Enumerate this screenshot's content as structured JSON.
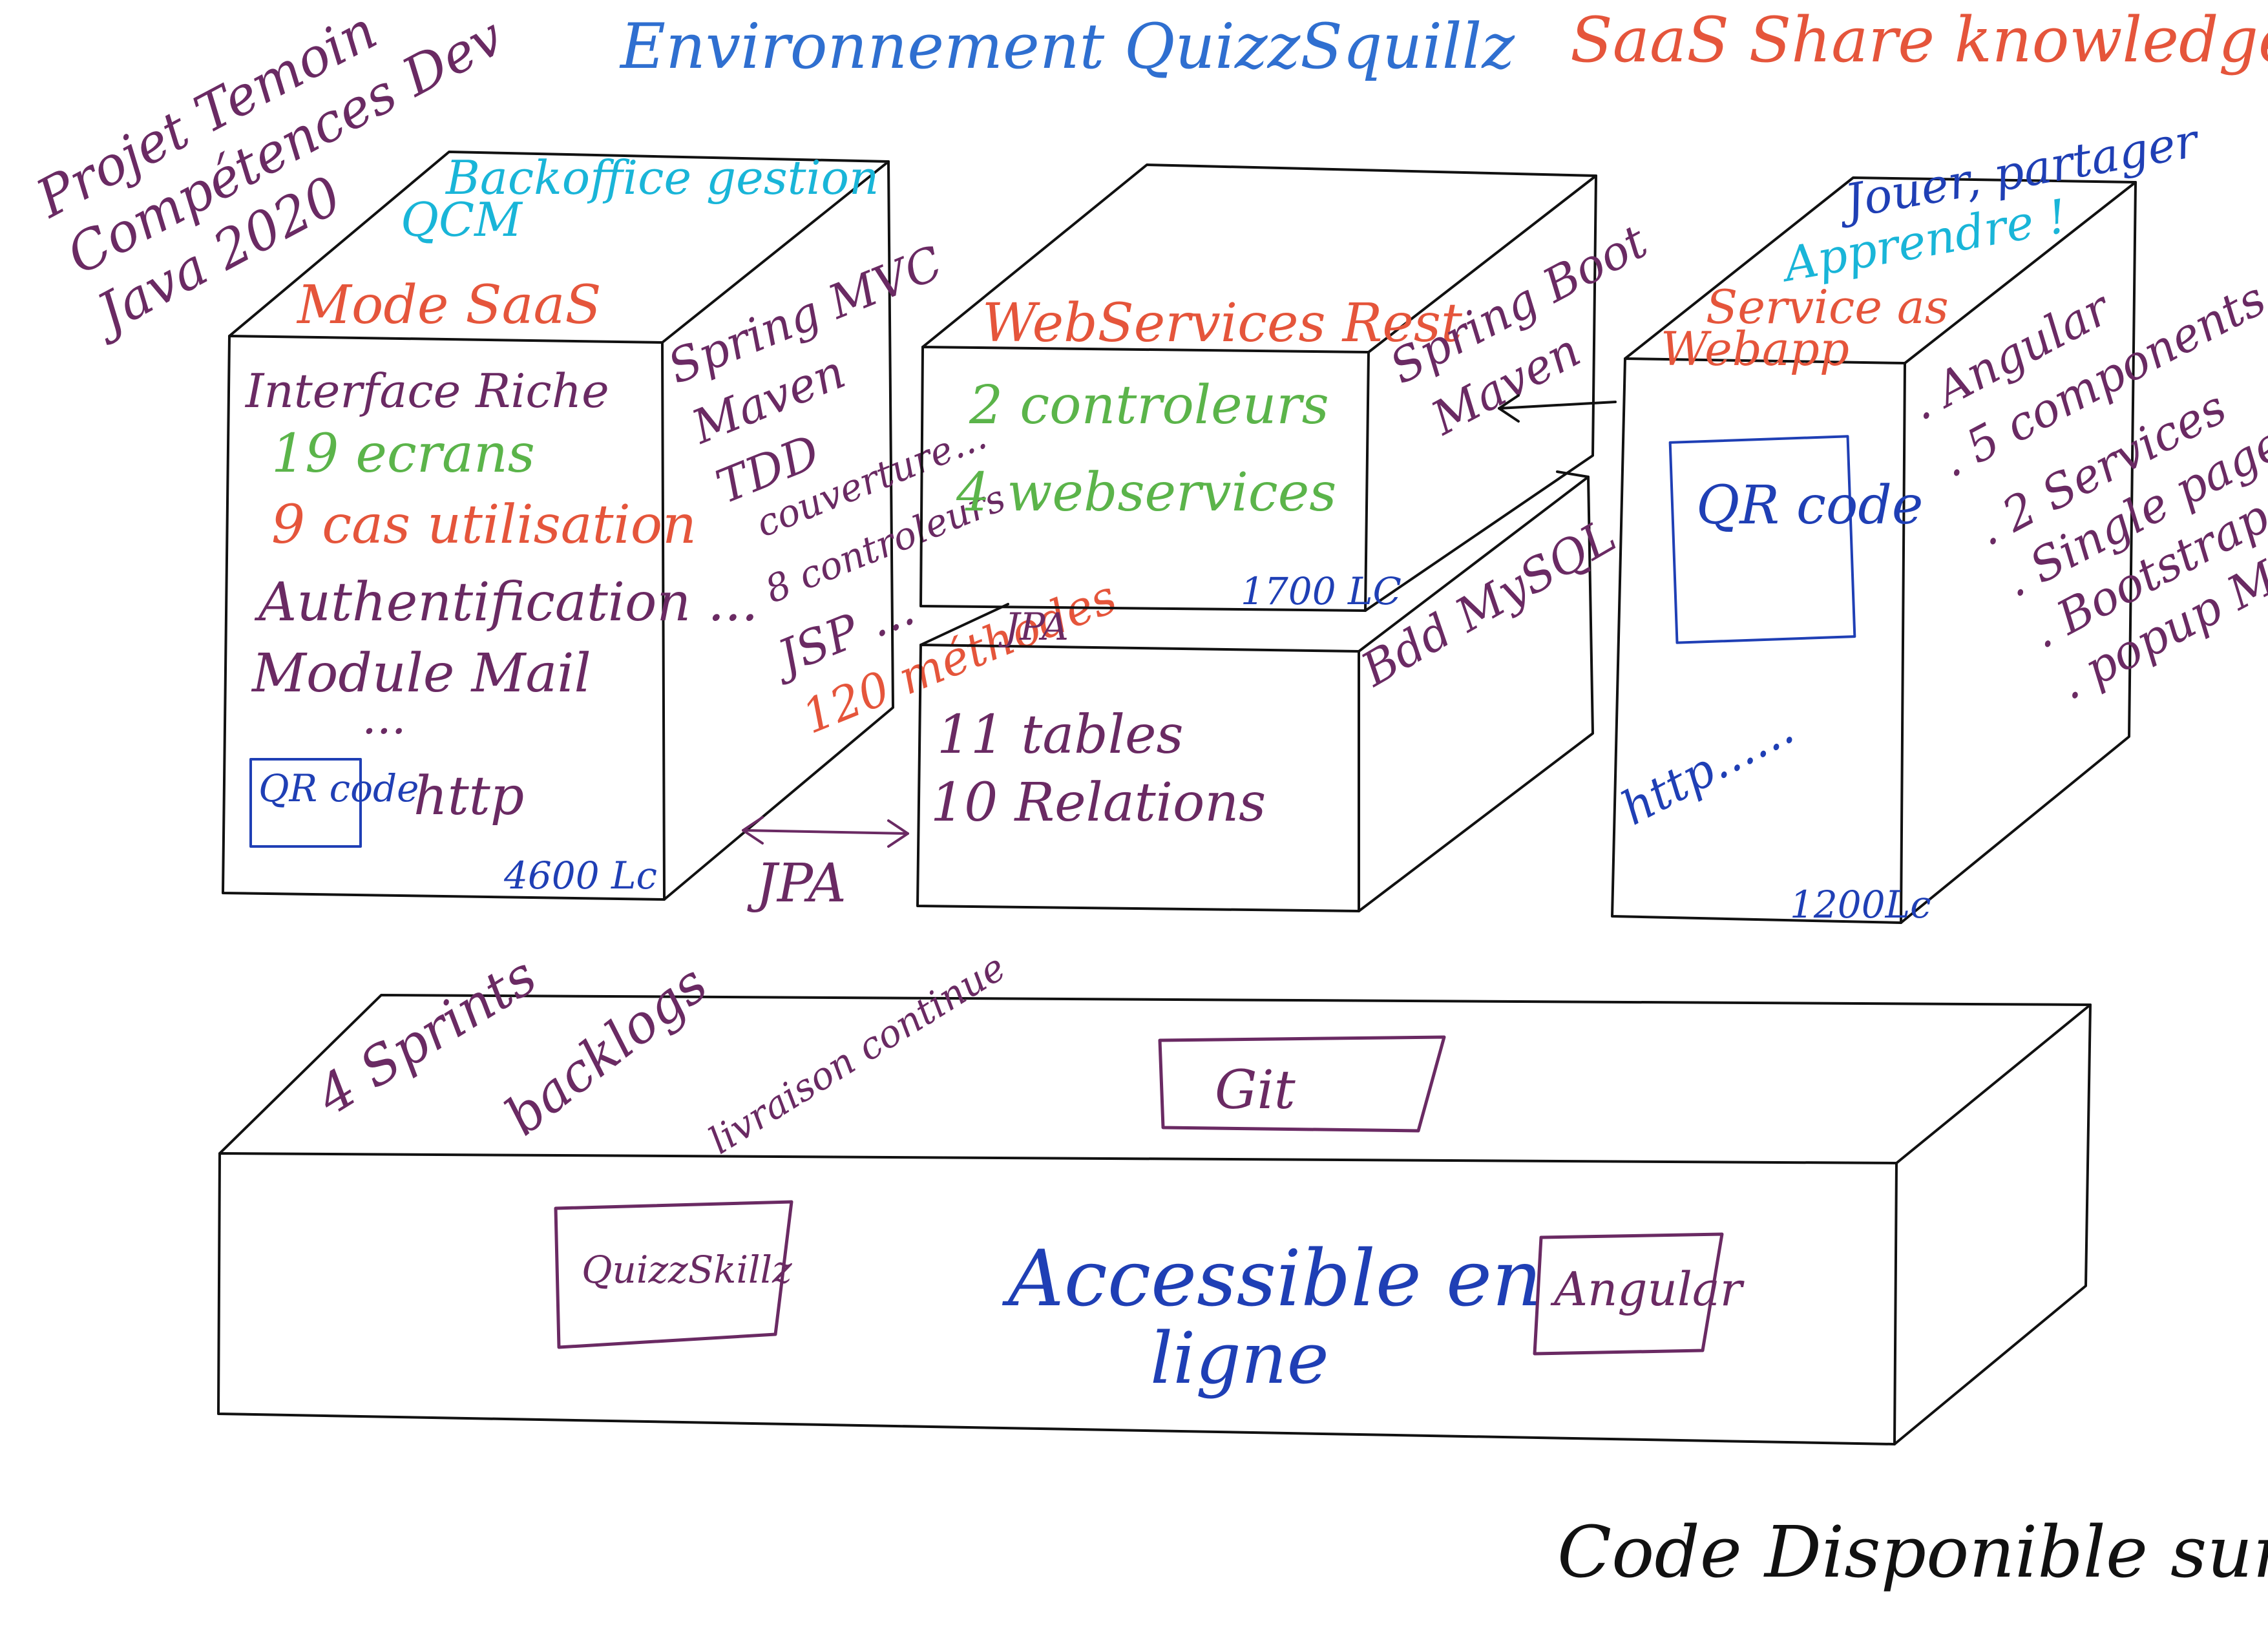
{
  "colors": {
    "blue": "#2f6fd0",
    "red": "#e5553b",
    "purple": "#6a2a63",
    "green": "#5bb44a",
    "cyan": "#19b5d8",
    "black": "#111111",
    "navy": "#1f3fb5"
  },
  "header": {
    "title": "Environnement QuizzSquillz",
    "saas_tag": "SaaS Share knowledge"
  },
  "project_note": {
    "line1": "Projet Temoin",
    "line2": "Compétences Dev",
    "line3": "Java 2020"
  },
  "boxes": {
    "backoffice": {
      "top_caption_1": "Backoffice gestion",
      "top_caption_2": "QCM",
      "mode_label": "Mode SaaS",
      "front_lines": [
        "Interface Riche",
        "19 ecrans",
        "9 cas utilisation",
        "Authentification ...",
        "Module Mail",
        "..."
      ],
      "qr_label": "QR code",
      "http_label": "http",
      "loc": "4600 Lc",
      "side_lines": [
        "Spring MVC",
        "Maven",
        "TDD",
        "couverture...",
        "8 controleurs",
        "JSP ...",
        "120 méthodes"
      ]
    },
    "webservices": {
      "title": "WebServices Rest",
      "front_lines": [
        "2 controleurs",
        "4 webservices"
      ],
      "loc": "1700 LC",
      "side_lines": [
        "Spring Boot",
        "Maven"
      ]
    },
    "database": {
      "jpa_top": "JPA",
      "front_lines": [
        "11 tables",
        "10 Relations"
      ],
      "side_label": "Bdd MySQL",
      "jpa_arrow_label": "JPA"
    },
    "webapp": {
      "top_caption_1": "Jouer, partager",
      "top_caption_2": "Apprendre !",
      "title_1": "Service as",
      "title_2": "Webapp",
      "qr_label": "QR code",
      "http_label": "http......",
      "loc": "1200Lc",
      "side_lines": [
        ". Angular",
        ". 5 components",
        ". 2 Services",
        ". Single page",
        ". Bootstrap",
        ". popup Media"
      ]
    },
    "platform": {
      "top_items": [
        "4 Sprints",
        "backlogs",
        "livraison continue"
      ],
      "git_label": "Git",
      "front_center_1": "Accessible en",
      "front_center_2": "ligne",
      "left_badge": "QuizzSkillz",
      "right_badge": "Angular"
    }
  },
  "footer": {
    "note": "Code Disponible sur Git"
  }
}
